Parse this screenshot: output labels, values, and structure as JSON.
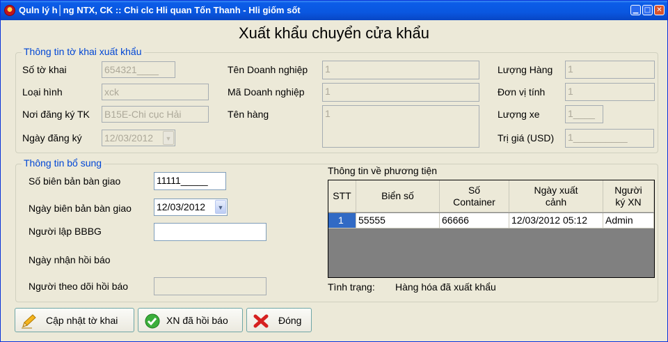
{
  "window": {
    "title": "Quln lý h│ng NTX, CK :: Chi clc Hli quan Tốn Thanh - Hli giốm sốt",
    "minimize": "▁",
    "maximize": "□",
    "close": "✕"
  },
  "form_title": "Xuất khẩu chuyển cửa khẩu",
  "export_info": {
    "legend": "Thông tin tờ khai xuất khẩu",
    "so_to_khai_label": "Số tờ khai",
    "so_to_khai_value": "654321____",
    "loai_hinh_label": "Loại hình",
    "loai_hinh_value": "xck",
    "noi_dang_ky_label": "Nơi đăng ký TK",
    "noi_dang_ky_value": "B15E-Chi cục Hải",
    "ngay_dang_ky_label": "Ngày đăng ký",
    "ngay_dang_ky_value": "12/03/2012",
    "ten_dn_label": "Tên Doanh nghiệp",
    "ten_dn_value": "1",
    "ma_dn_label": "Mã Doanh nghiệp",
    "ma_dn_value": "1",
    "ten_hang_label": "Tên hàng",
    "ten_hang_value": "1",
    "luong_hang_label": "Lượng Hàng",
    "luong_hang_value": "1",
    "don_vi_tinh_label": "Đơn vị tính",
    "don_vi_tinh_value": "1",
    "luong_xe_label": "Lượng xe",
    "luong_xe_value": "1____",
    "tri_gia_label": "Trị giá (USD)",
    "tri_gia_value": "1__________"
  },
  "additional_info": {
    "legend": "Thông tin bổ sung",
    "so_bbbg_label": "Số biên bản bàn giao",
    "so_bbbg_value": "11111_____",
    "ngay_bbbg_label": "Ngày biên bản bàn giao",
    "ngay_bbbg_value": "12/03/2012",
    "nguoi_lap_label": "Người lập BBBG",
    "nguoi_lap_value": "",
    "ngay_nhan_label": "Ngày nhận hồi báo",
    "nguoi_theo_doi_label": "Người theo dõi hồi báo",
    "nguoi_theo_doi_value": ""
  },
  "vehicle": {
    "title": "Thông tin về phương tiện",
    "columns": [
      "STT",
      "Biển số",
      "Số Container",
      "Ngày xuất cảnh",
      "Người ký XN"
    ],
    "rows": [
      {
        "stt": "1",
        "bien_so": "55555",
        "container": "66666",
        "ngay_xuat": "12/03/2012 05:12",
        "nguoi_ky": "Admin"
      }
    ],
    "status_label": "Tình trạng:",
    "status_value": "Hàng hóa đã xuất khẩu"
  },
  "buttons": {
    "update": "Cập nhật tờ khai",
    "confirm": "XN đã hồi báo",
    "close": "Đóng"
  },
  "colors": {
    "titlebar": "#0a57e0",
    "legend_text": "#0046d5",
    "selection": "#316ac5",
    "grid_empty": "#808080"
  }
}
